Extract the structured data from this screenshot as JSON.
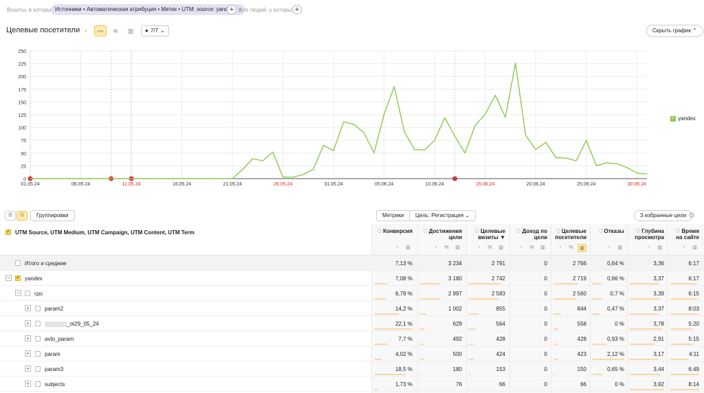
{
  "filter": {
    "prefix": "Визиты, в которых",
    "chip": "Источники • Автоматическая атрибуция • Метки • UTM: source: yandex",
    "chip_close": "×",
    "add": "+",
    "mid": "для людей, у которых"
  },
  "chart_header": {
    "title": "Целевые посетители",
    "series_count": "7/7",
    "hide_chart": "Скрыть график"
  },
  "chart_data": {
    "type": "line",
    "y_ticks": [
      "0",
      "25",
      "50",
      "75",
      "100",
      "125",
      "150",
      "175",
      "200",
      "225",
      "250"
    ],
    "ylim": [
      0,
      250
    ],
    "x_ticks": [
      {
        "label": "01.05.24",
        "red": false
      },
      {
        "label": "06.05.24",
        "red": false
      },
      {
        "label": "11.05.24",
        "red": true
      },
      {
        "label": "16.05.24",
        "red": false
      },
      {
        "label": "21.05.24",
        "red": false
      },
      {
        "label": "26.05.24",
        "red": true
      },
      {
        "label": "31.05.24",
        "red": false
      },
      {
        "label": "05.06.24",
        "red": false
      },
      {
        "label": "10.06.24",
        "red": false
      },
      {
        "label": "15.06.24",
        "red": true
      },
      {
        "label": "20.06.24",
        "red": false
      },
      {
        "label": "25.06.24",
        "red": false
      },
      {
        "label": "30.06.24",
        "red": true
      }
    ],
    "series": [
      {
        "name": "yandex",
        "color": "#8ec84b",
        "values": [
          0,
          0,
          0,
          0,
          0,
          0,
          0,
          0,
          0,
          0,
          0,
          0,
          0,
          0,
          0,
          0,
          0,
          0,
          0,
          0,
          0,
          18,
          39,
          35,
          52,
          3,
          3,
          8,
          18,
          65,
          55,
          111,
          106,
          90,
          50,
          126,
          180,
          92,
          57,
          56,
          75,
          119,
          83,
          50,
          104,
          126,
          163,
          120,
          226,
          85,
          57,
          71,
          41,
          40,
          35,
          75,
          25,
          31,
          29,
          22,
          11,
          9
        ]
      }
    ],
    "event_markers": [
      "01.05.24",
      "09.05.24",
      "11.05.24",
      "12.06.24"
    ],
    "grid": true,
    "legend_position": "right"
  },
  "toolbar": {
    "groupings": "Группировки",
    "metrics": "Метрики",
    "goal": "Цель: Регистрация",
    "favorites": "3 избранные цели"
  },
  "table": {
    "dimension_title": "UTM Source, UTM Medium, UTM Campaign, UTM Content, UTM Term",
    "columns": [
      {
        "l1": "Конверсия",
        "l2": ""
      },
      {
        "l1": "Достижения",
        "l2": "цели"
      },
      {
        "l1": "Целевые",
        "l2": "визиты ▼"
      },
      {
        "l1": "Доход по",
        "l2": "цели"
      },
      {
        "l1": "Целевые",
        "l2": "посетители"
      },
      {
        "l1": "Отказы",
        "l2": ""
      },
      {
        "l1": "Глубина",
        "l2": "просмотра"
      },
      {
        "l1": "Время",
        "l2": "на сайте"
      }
    ],
    "rows": [
      {
        "label": "Итого и средние",
        "values": [
          "7,13 %",
          "3 234",
          "2 791",
          "0",
          "2 766",
          "0,64 %",
          "3,36",
          "6:17"
        ]
      },
      {
        "label": "yandex",
        "values": [
          "7,08 %",
          "3 180",
          "2 742",
          "0",
          "2 719",
          "0,66 %",
          "3,37",
          "6:17"
        ]
      },
      {
        "label": "cpc",
        "values": [
          "6,79 %",
          "2 997",
          "2 583",
          "0",
          "2 560",
          "0,7 %",
          "3,39",
          "6:15"
        ]
      },
      {
        "label": "param2",
        "values": [
          "14,2 %",
          "1 002",
          "855",
          "0",
          "844",
          "0,47 %",
          "3,37",
          "8:03"
        ]
      },
      {
        "label": "_ot29_05_24",
        "values": [
          "22,1 %",
          "629",
          "564",
          "0",
          "558",
          "0 %",
          "3,78",
          "5:20"
        ]
      },
      {
        "label": "avto_param",
        "values": [
          "7,7 %",
          "492",
          "428",
          "0",
          "428",
          "0,93 %",
          "2,91",
          "5:15"
        ]
      },
      {
        "label": "param",
        "values": [
          "4,02 %",
          "500",
          "424",
          "0",
          "423",
          "2,12 %",
          "3,17",
          "4:11"
        ]
      },
      {
        "label": "param3",
        "values": [
          "18,5 %",
          "180",
          "153",
          "0",
          "150",
          "0,65 %",
          "3,44",
          "6:49"
        ]
      },
      {
        "label": "subjects",
        "values": [
          "1,73 %",
          "76",
          "66",
          "0",
          "66",
          "0 %",
          "3,92",
          "8:14"
        ]
      }
    ],
    "bar_fractions": [
      [
        0.32,
        0.5,
        0.88,
        0,
        0.76,
        0.3,
        0.86,
        0.94
      ],
      [
        0.32,
        0.49,
        0.86,
        0,
        0.75,
        0.31,
        0.86,
        0.94
      ],
      [
        0.3,
        0.46,
        0.82,
        0,
        0.7,
        0.33,
        0.87,
        0.93
      ],
      [
        0.64,
        0.16,
        0.27,
        0,
        0.23,
        0.22,
        0.86,
        1.0
      ],
      [
        1.0,
        0.1,
        0.18,
        0,
        0.15,
        0,
        0.96,
        0.79
      ],
      [
        0.35,
        0.08,
        0.14,
        0,
        0.12,
        0.44,
        0.74,
        0.78
      ],
      [
        0.18,
        0.08,
        0.13,
        0,
        0.12,
        1.0,
        0.81,
        0.62
      ],
      [
        0.84,
        0.03,
        0.05,
        0,
        0.04,
        0.31,
        0.88,
        1.0
      ],
      [
        0.08,
        0.01,
        0.02,
        0,
        0.02,
        0,
        1.0,
        1.0
      ]
    ]
  }
}
